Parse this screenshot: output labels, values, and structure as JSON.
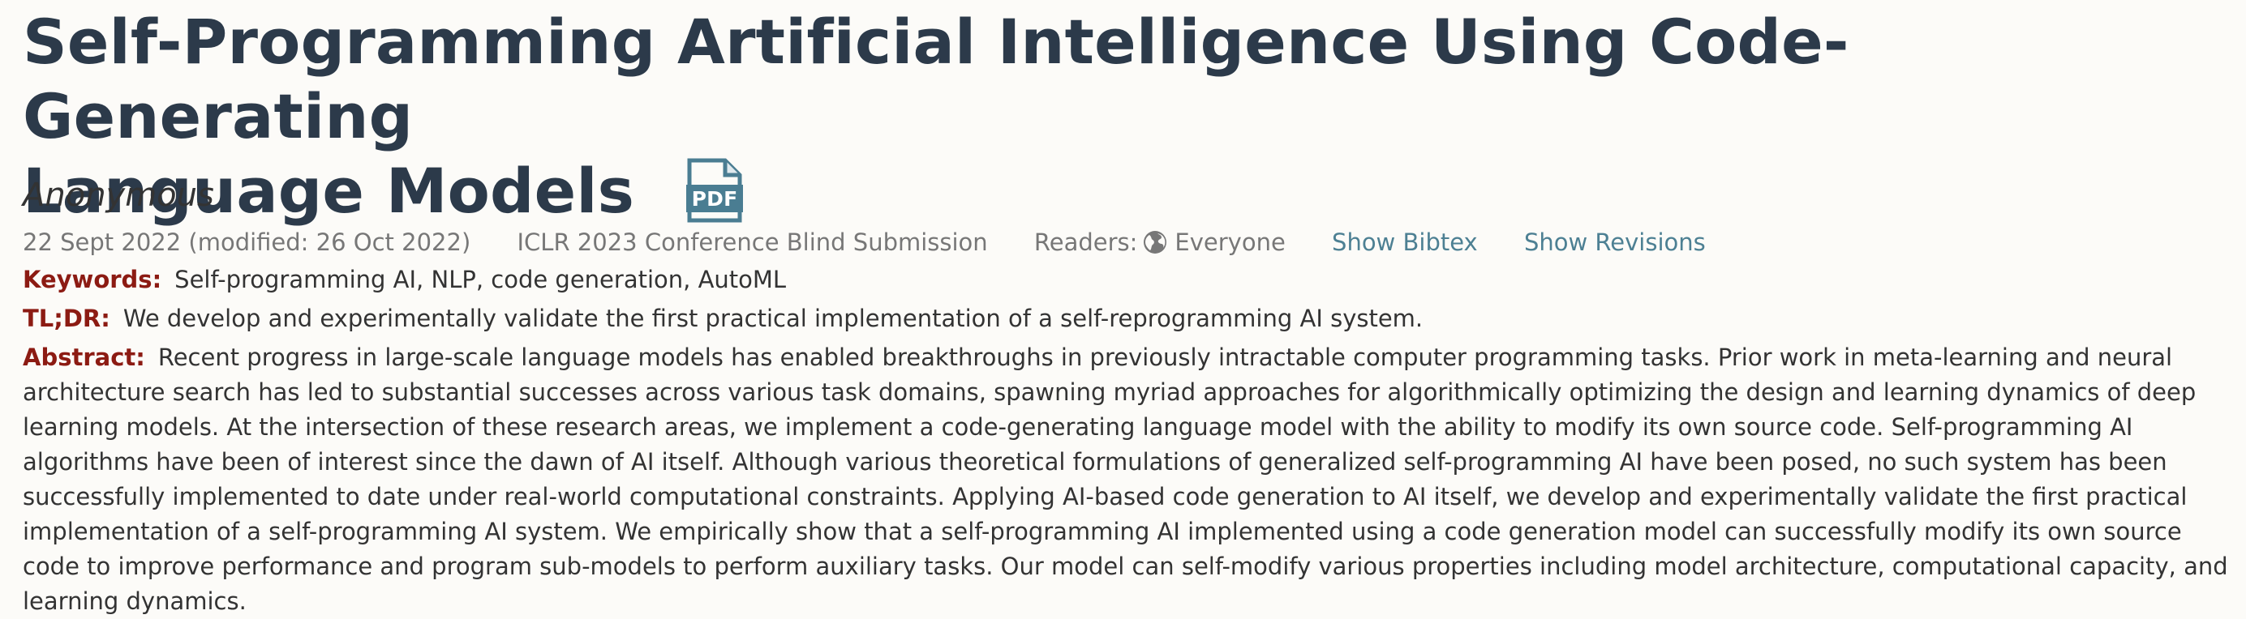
{
  "paper": {
    "title_line1": "Self-Programming Artificial Intelligence Using Code-Generating",
    "title_line2": "Language Models",
    "pdf_label": "PDF",
    "authors": "Anonymous"
  },
  "meta": {
    "date": "22 Sept 2022 (modified: 26 Oct 2022)",
    "venue": "ICLR 2023 Conference Blind Submission",
    "readers_label": "Readers:",
    "readers_icon": "globe-icon",
    "readers_value": "Everyone",
    "bibtex_link": "Show Bibtex",
    "revisions_link": "Show Revisions"
  },
  "fields": {
    "keywords_label": "Keywords:",
    "keywords_value": "Self-programming AI, NLP, code generation, AutoML",
    "tldr_label": "TL;DR:",
    "tldr_value": "We develop and experimentally validate the first practical implementation of a self-reprogramming AI system.",
    "abstract_label": "Abstract:",
    "abstract_value": "Recent progress in large-scale language models has enabled breakthroughs in previously intractable computer programming tasks. Prior work in meta-learning and neural architecture search has led to substantial successes across various task domains, spawning myriad approaches for algorithmically optimizing the design and learning dynamics of deep learning models. At the intersection of these research areas, we implement a code-generating language model with the ability to modify its own source code. Self-programming AI algorithms have been of interest since the dawn of AI itself. Although various theoretical formulations of generalized self-programming AI have been posed, no such system has been successfully implemented to date under real-world computational constraints. Applying AI-based code generation to AI itself, we develop and experimentally validate the first practical implementation of a self-programming AI system. We empirically show that a self-programming AI implemented using a code generation model can successfully modify its own source code to improve performance and program sub-models to perform auxiliary tasks. Our model can self-modify various properties including model architecture, computational capacity, and learning dynamics."
  },
  "colors": {
    "title": "#2c3a4a",
    "label": "#8c1b13",
    "link": "#4d8093",
    "meta": "#777777",
    "background": "#fcfbf8"
  }
}
